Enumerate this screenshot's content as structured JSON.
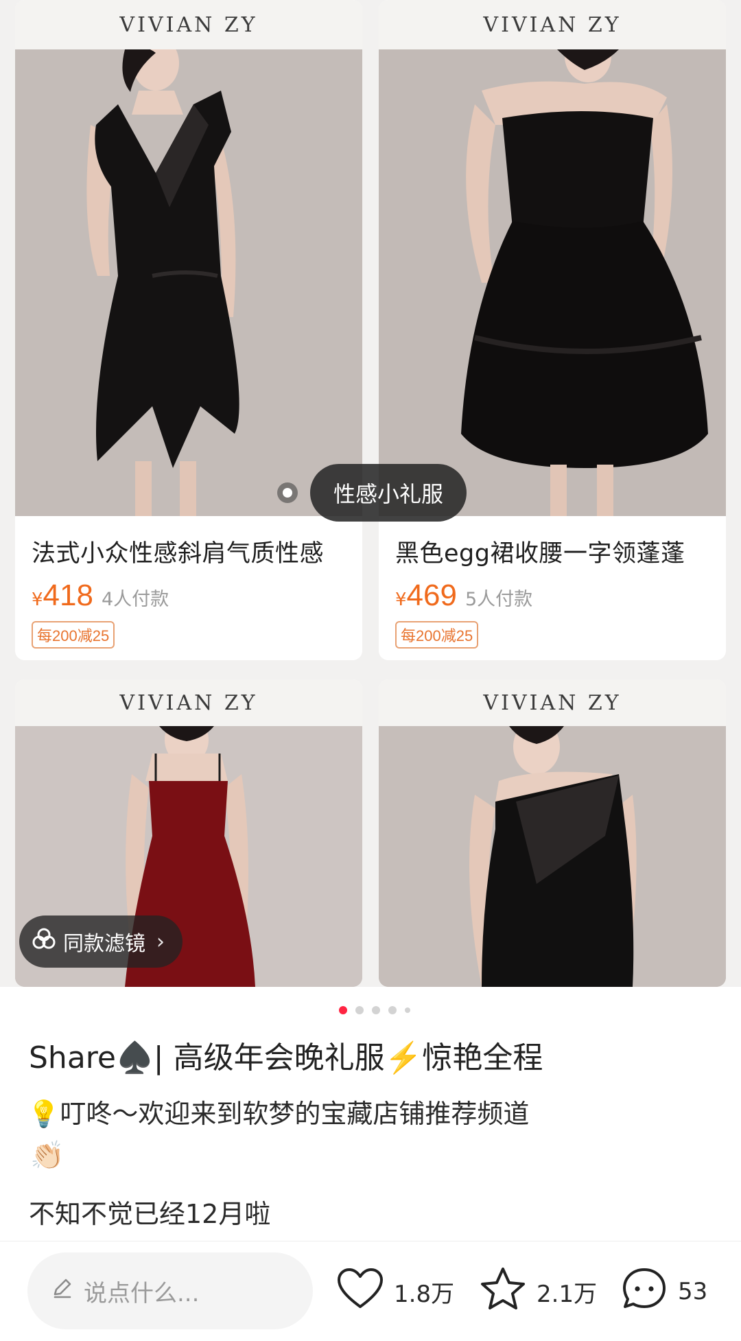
{
  "products": [
    {
      "brand": "VIVIAN ZY",
      "title": "法式小众性感斜肩气质性感",
      "currency": "¥",
      "price": "418",
      "payers": "4人付款",
      "coupon": "每200减25"
    },
    {
      "brand": "VIVIAN ZY",
      "title": "黑色egg裙收腰一字领蓬蓬",
      "currency": "¥",
      "price": "469",
      "payers": "5人付款",
      "coupon": "每200减25"
    },
    {
      "brand": "VIVIAN ZY"
    },
    {
      "brand": "VIVIAN ZY"
    }
  ],
  "image_tag": "性感小礼服",
  "filter_chip": {
    "label": "同款滤镜",
    "chevron": "›"
  },
  "carousel": {
    "total": 5,
    "active_index": 0
  },
  "note": {
    "title": "Share♠️| 高级年会晚礼服⚡️惊艳全程",
    "line1": "💡叮咚～欢迎来到软梦的宝藏店铺推荐频道",
    "line2": "👏🏻",
    "line3": "不知不觉已经12月啦"
  },
  "bottom_bar": {
    "comment_placeholder": "说点什么...",
    "likes": "1.8万",
    "favorites": "2.1万",
    "comments": "53"
  },
  "colors": {
    "accent": "#ff2442",
    "price": "#f06a1c",
    "coupon": "#e8742f"
  }
}
